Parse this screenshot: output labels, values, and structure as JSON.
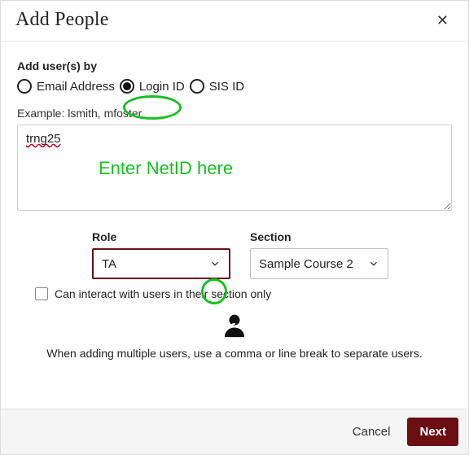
{
  "header": {
    "title": "Add People",
    "close_glyph": "✕"
  },
  "add_by": {
    "label": "Add user(s) by",
    "options": [
      {
        "label": "Email Address",
        "selected": false
      },
      {
        "label": "Login ID",
        "selected": true
      },
      {
        "label": "SIS ID",
        "selected": false
      }
    ]
  },
  "input": {
    "example": "Example: lsmith, mfoster",
    "value": "trng25",
    "annotation": "Enter NetID here"
  },
  "role": {
    "label": "Role",
    "value": "TA"
  },
  "section": {
    "label": "Section",
    "value": "Sample Course 2"
  },
  "restrict": {
    "label": "Can interact with users in their section only",
    "checked": false
  },
  "info": {
    "text": "When adding multiple users, use a comma or line break to separate users."
  },
  "footer": {
    "cancel": "Cancel",
    "next": "Next"
  },
  "colors": {
    "accent": "#6a0e12",
    "annotation": "#18c020"
  }
}
